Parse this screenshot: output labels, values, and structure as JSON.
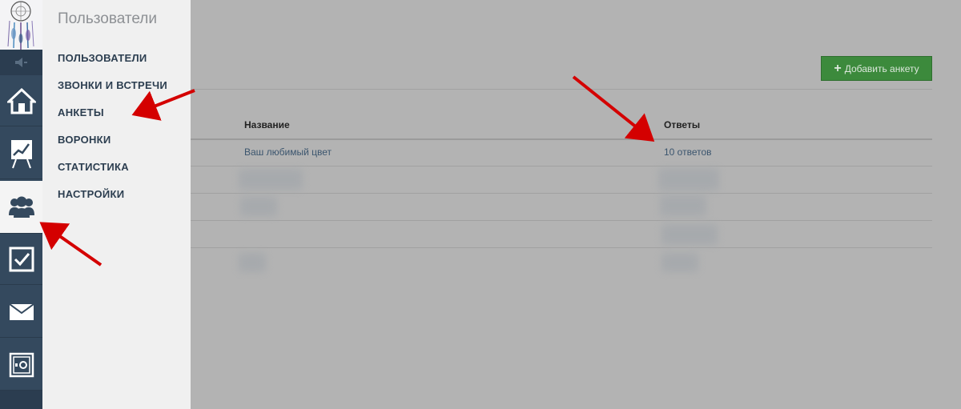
{
  "flyout": {
    "title": "Пользователи",
    "items": [
      {
        "label": "ПОЛЬЗОВАТЕЛИ"
      },
      {
        "label": "ЗВОНКИ И ВСТРЕЧИ"
      },
      {
        "label": "АНКЕТЫ"
      },
      {
        "label": "ВОРОНКИ"
      },
      {
        "label": "СТАТИСТИКА"
      },
      {
        "label": "НАСТРОЙКИ"
      }
    ]
  },
  "sidebar": {
    "icons": [
      "speaker-icon",
      "home-icon",
      "chart-icon",
      "users-icon",
      "checkbox-icon",
      "mail-icon",
      "safe-icon"
    ]
  },
  "main": {
    "add_button_label": "Добавить анкету",
    "table": {
      "columns": [
        "Название",
        "Ответы"
      ],
      "rows": [
        {
          "name": "Ваш любимый цвет",
          "answers": "10 ответов"
        }
      ]
    }
  },
  "colors": {
    "rail": "#34495e",
    "accent_green": "#3c8a3c",
    "annotation_arrow": "#d40000",
    "overlay": "#b3b3b3"
  }
}
